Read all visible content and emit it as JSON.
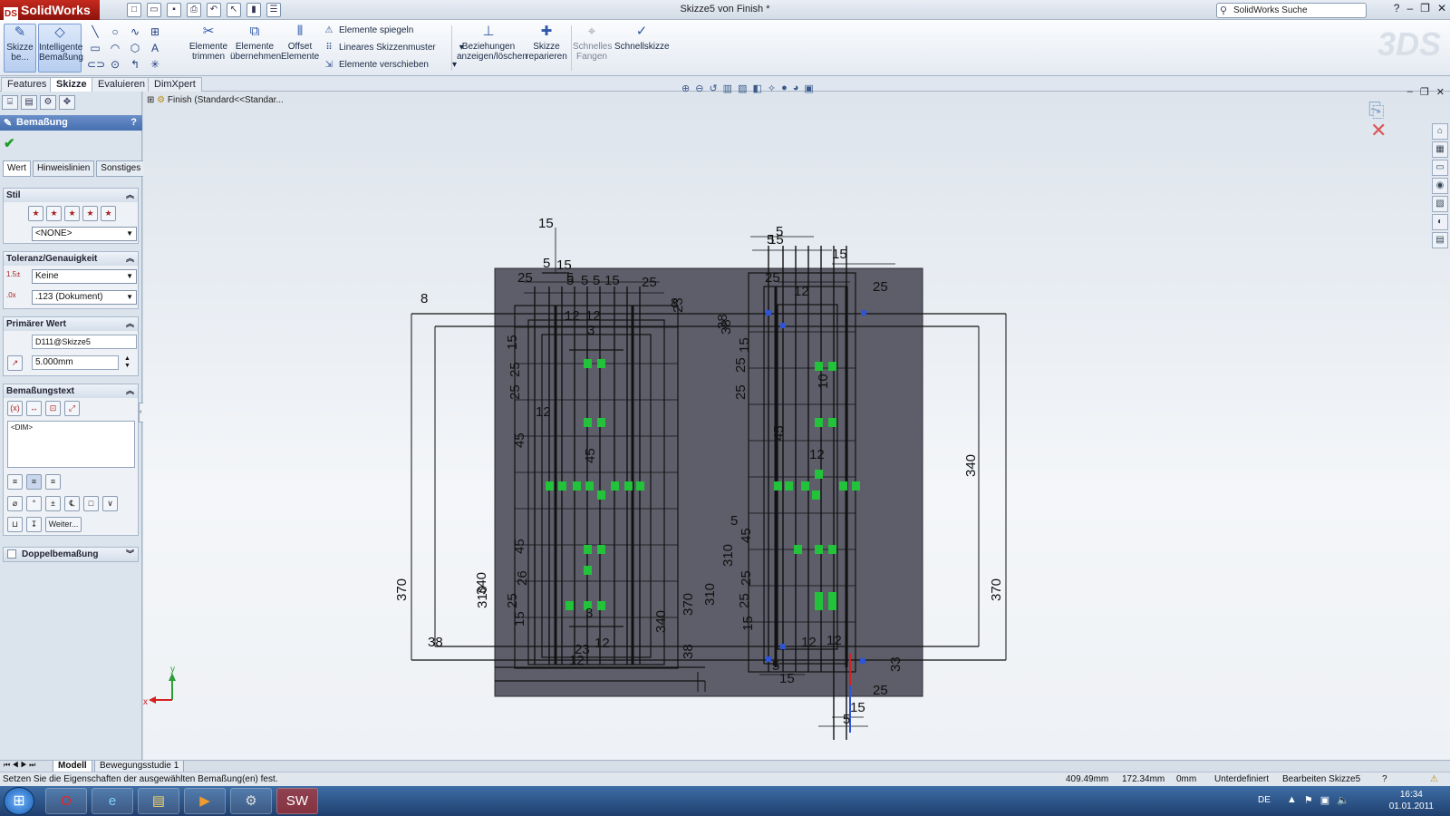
{
  "app": {
    "name": "SolidWorks",
    "doc_title": "Skizze5 von Finish *",
    "search_placeholder": "SolidWorks Suche"
  },
  "ribbon": {
    "sketch_label": "Skizze be...",
    "smart_dim_label": "Intelligente Bemaßung",
    "trim_label": "Elemente trimmen",
    "convert_label": "Elemente übernehmen",
    "offset_label": "Offset Elemente",
    "mirror_label": "Elemente spiegeln",
    "pattern_label": "Lineares Skizzenmuster",
    "move_label": "Elemente verschieben",
    "relations_label": "Beziehungen anzeigen/löschen",
    "repair_label": "Skizze reparieren",
    "snap_label": "Schnelles Fangen",
    "quick_sketch_label": "Schnellskizze"
  },
  "cm_tabs": [
    "Features",
    "Skizze",
    "Evaluieren",
    "DimXpert"
  ],
  "panel": {
    "title": "Bemaßung",
    "tabs": [
      "Wert",
      "Hinweislinien",
      "Sonstiges"
    ],
    "stil": {
      "header": "Stil",
      "value": "<NONE>"
    },
    "toleranz": {
      "header": "Toleranz/Genauigkeit",
      "type": "Keine",
      "precision": ".123 (Dokument)"
    },
    "primary": {
      "header": "Primärer Wert",
      "name": "D111@Skizze5",
      "value": "5.000mm"
    },
    "dim_text": {
      "header": "Bemaßungstext",
      "content": "<DIM>",
      "more": "Weiter..."
    },
    "dual": {
      "header": "Doppelbemaßung"
    }
  },
  "tree": {
    "item": "Finish  (Standard<<Standar..."
  },
  "sketch": {
    "dims_left": [
      "15",
      "5",
      "15",
      "5",
      "25",
      "5",
      "5",
      "5",
      "15",
      "25",
      "8",
      "8",
      "23",
      "12",
      "12",
      "3",
      "38",
      "15",
      "25",
      "25",
      "12",
      "45",
      "45",
      "45",
      "340",
      "370",
      "310",
      "26",
      "25",
      "15",
      "370",
      "340",
      "38",
      "23",
      "12",
      "38",
      "12",
      "3"
    ],
    "dims_right": [
      "5",
      "5",
      "15",
      "15",
      "25",
      "12",
      "25",
      "38",
      "15",
      "25",
      "25",
      "10",
      "12",
      "45",
      "340",
      "5",
      "45",
      "310",
      "310",
      "25",
      "25",
      "15",
      "370",
      "12",
      "12",
      "5",
      "15",
      "33",
      "25",
      "15",
      "5"
    ],
    "axis_x": "x",
    "axis_y": "y"
  },
  "model_tabs": [
    "Modell",
    "Bewegungsstudie 1"
  ],
  "status": {
    "message": "Setzen Sie die Eigenschaften der ausgewählten Bemaßung(en) fest.",
    "x": "409.49mm",
    "y": "172.34mm",
    "z": "0mm",
    "state": "Unterdefiniert",
    "mode": "Bearbeiten Skizze5"
  },
  "taskbar": {
    "lang": "DE",
    "time": "16:34",
    "date": "01.01.2011"
  },
  "colors": {
    "plate": "#5d5e69",
    "constraint_green": "#22c33a",
    "dimension_text": "#111111",
    "title_red": "#b31b12"
  }
}
